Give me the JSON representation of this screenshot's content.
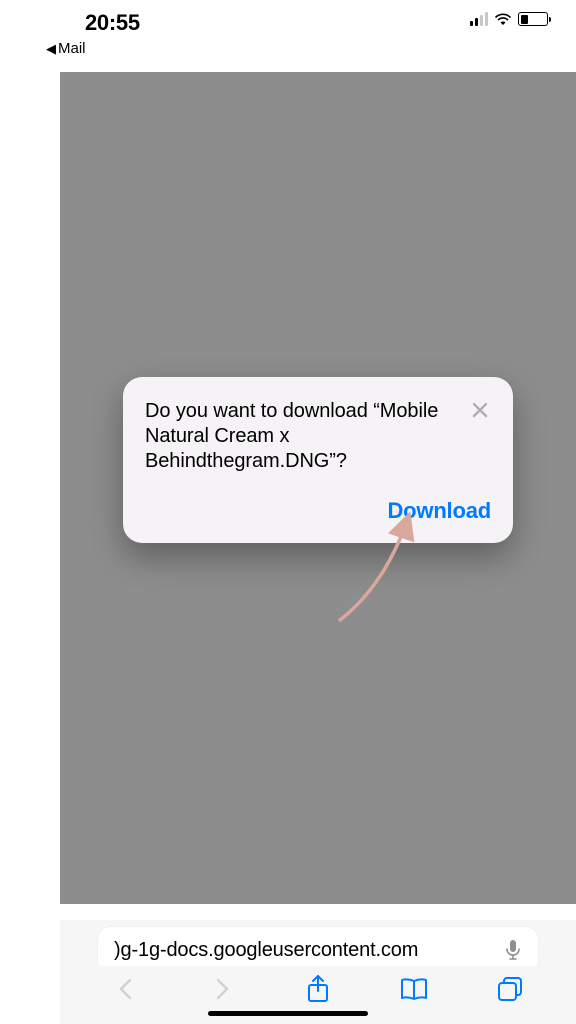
{
  "status_bar": {
    "time": "20:55",
    "back_app": "Mail"
  },
  "alert": {
    "text": "Do you want to download “Mobile Natural Cream x Behindthegram.DNG”?",
    "download_label": "Download"
  },
  "address_bar": {
    "url_visible": ")g-1g-docs.googleusercontent.com"
  },
  "colors": {
    "accent_blue": "#007aff",
    "bg_gray": "#8d8d8d"
  }
}
